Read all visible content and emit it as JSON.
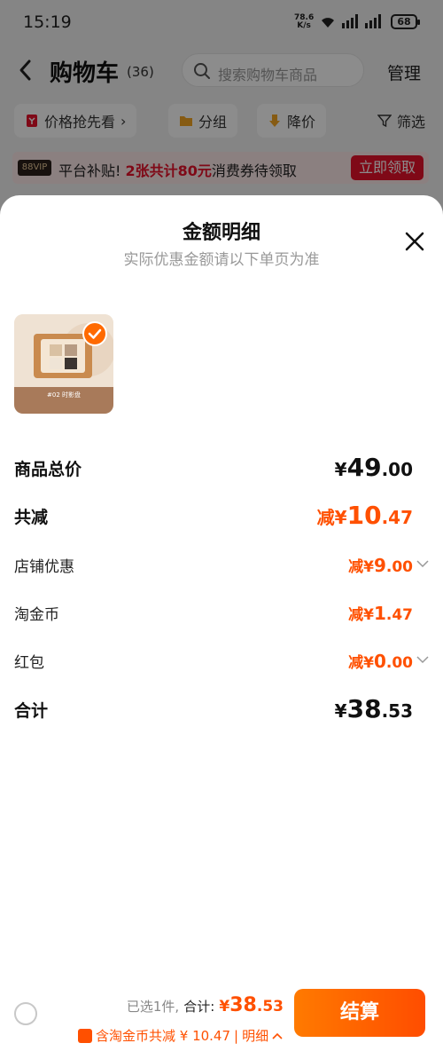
{
  "status_bar": {
    "time": "15:19",
    "net_speed": "78.6",
    "net_unit": "K/s",
    "battery": "68"
  },
  "header": {
    "title": "购物车",
    "count": "(36)",
    "search_placeholder": "搜索购物车商品",
    "manage": "管理"
  },
  "filters": [
    {
      "label": "价格抢先看",
      "icon": "price-tag-icon"
    },
    {
      "label": "分组",
      "icon": "folder-icon"
    },
    {
      "label": "降价",
      "icon": "arrow-down-icon"
    },
    {
      "label": "筛选",
      "icon": "filter-icon"
    }
  ],
  "banner": {
    "badge": "88VIP",
    "text_prefix": "平台补贴!",
    "text_highlight": "2张共计80元",
    "text_suffix": "消费券待领取",
    "button": "立即领取"
  },
  "sheet": {
    "title": "金额明细",
    "subtitle": "实际优惠金额请以下单页为准",
    "product_label": "#02 时影盘",
    "rows": [
      {
        "label": "商品总价",
        "prefix": "¥",
        "int": "49",
        "dec": ".00"
      },
      {
        "label": "共减",
        "prefix": "减¥",
        "int": "10",
        "dec": ".47"
      },
      {
        "label": "店铺优惠",
        "prefix": "减¥",
        "int": "9",
        "dec": ".00"
      },
      {
        "label": "淘金币",
        "prefix": "减¥",
        "int": "1",
        "dec": ".47"
      },
      {
        "label": "红包",
        "prefix": "减¥",
        "int": "0",
        "dec": ".00"
      },
      {
        "label": "合计",
        "prefix": "¥",
        "int": "38",
        "dec": ".53"
      }
    ]
  },
  "bottom_bar": {
    "selected": "已选1件,",
    "total_label": "合计:",
    "total_prefix": "¥",
    "total_int": "38",
    "total_dec": ".53",
    "savings_text": "含淘金币共减 ¥ 10.47",
    "detail": "明细",
    "checkout": "结算"
  },
  "colors": {
    "accent": "#ff5000",
    "promo_red": "#e8122a",
    "checkout_gradient_start": "#ff7a00"
  }
}
